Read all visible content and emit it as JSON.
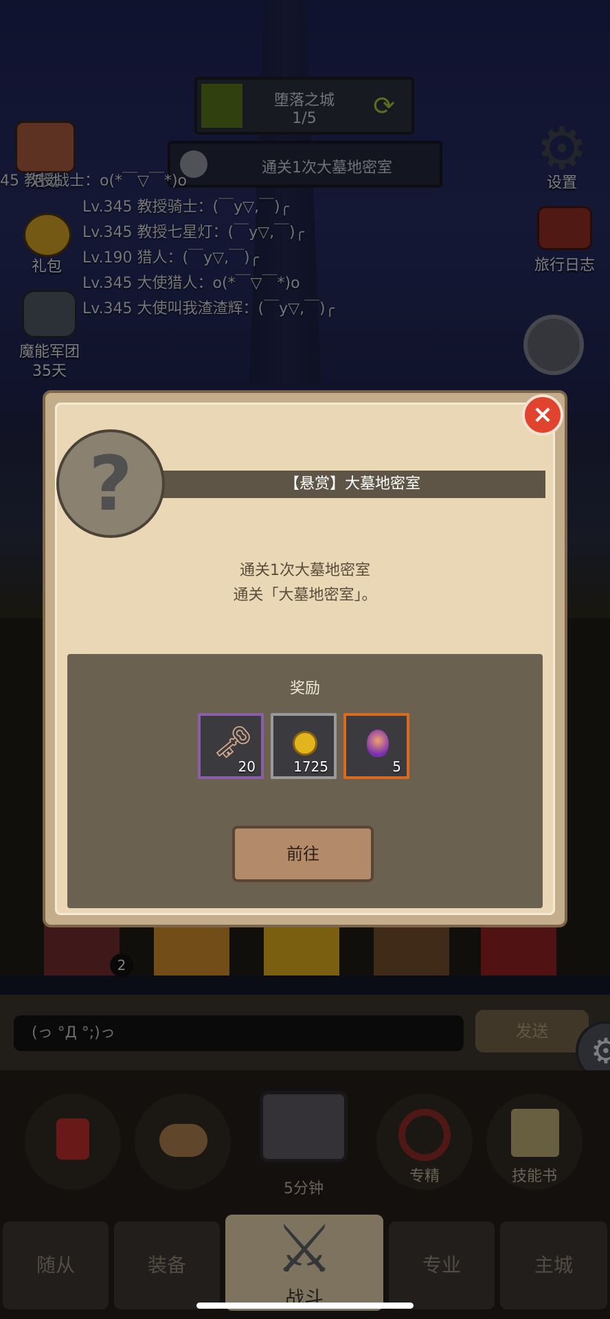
{
  "stage": {
    "title": "堕落之城",
    "progress": "1/5",
    "progress_fraction": 0.2
  },
  "quest_bar": {
    "text": "通关1次大墓地密室"
  },
  "left_icons": [
    {
      "label": "活动",
      "icon": "scroll-icon"
    },
    {
      "label": "礼包",
      "icon": "gold-pot-icon"
    },
    {
      "label": "魔能军团",
      "sublabel": "35天",
      "icon": "skull-icon"
    }
  ],
  "right_icons": [
    {
      "label": "设置",
      "icon": "gear-icon"
    },
    {
      "label": "旅行日志",
      "icon": "journal-icon"
    }
  ],
  "chat_lines": [
    "45 教授战士：o(*￣▽￣*)o",
    "Lv.345 教授骑士：(￣y▽,￣)╭",
    "Lv.345 教授七星灯：(￣y▽,￣)╭",
    "Lv.190 猎人：(￣y▽,￣)╭",
    "Lv.345 大使猎人：o(*￣▽￣*)o",
    "Lv.345 大使叫我渣渣辉：(￣y▽,￣)╭"
  ],
  "dialog": {
    "title": "【悬赏】大墓地密室",
    "desc_line1": "通关1次大墓地密室",
    "desc_line2": "通关「大墓地密室」。",
    "reward_title": "奖励",
    "rewards": [
      {
        "icon": "key-icon",
        "count": "20",
        "border": "#8a5fa8"
      },
      {
        "icon": "gold-coin-icon",
        "count": "1725",
        "border": "#9a9a9a"
      },
      {
        "icon": "purple-gem-icon",
        "count": "5",
        "border": "#d96a1e"
      }
    ],
    "goto_label": "前往",
    "close_label": "×"
  },
  "chat_input": {
    "placeholder": "(っ °Д °;)っ"
  },
  "send_label": "发送",
  "tile_badge": "2",
  "action_buttons": [
    {
      "label": "",
      "icon": "red-potion-icon"
    },
    {
      "label": "",
      "icon": "bread-icon"
    },
    {
      "label": "5分钟",
      "icon": "treasure-chest-icon"
    },
    {
      "label": "专精",
      "icon": "specialization-icon"
    },
    {
      "label": "技能书",
      "icon": "skill-book-icon"
    }
  ],
  "nav": {
    "items": [
      {
        "label": "随从"
      },
      {
        "label": "装备"
      },
      {
        "label": "战斗"
      },
      {
        "label": "专业"
      },
      {
        "label": "主城"
      }
    ]
  }
}
